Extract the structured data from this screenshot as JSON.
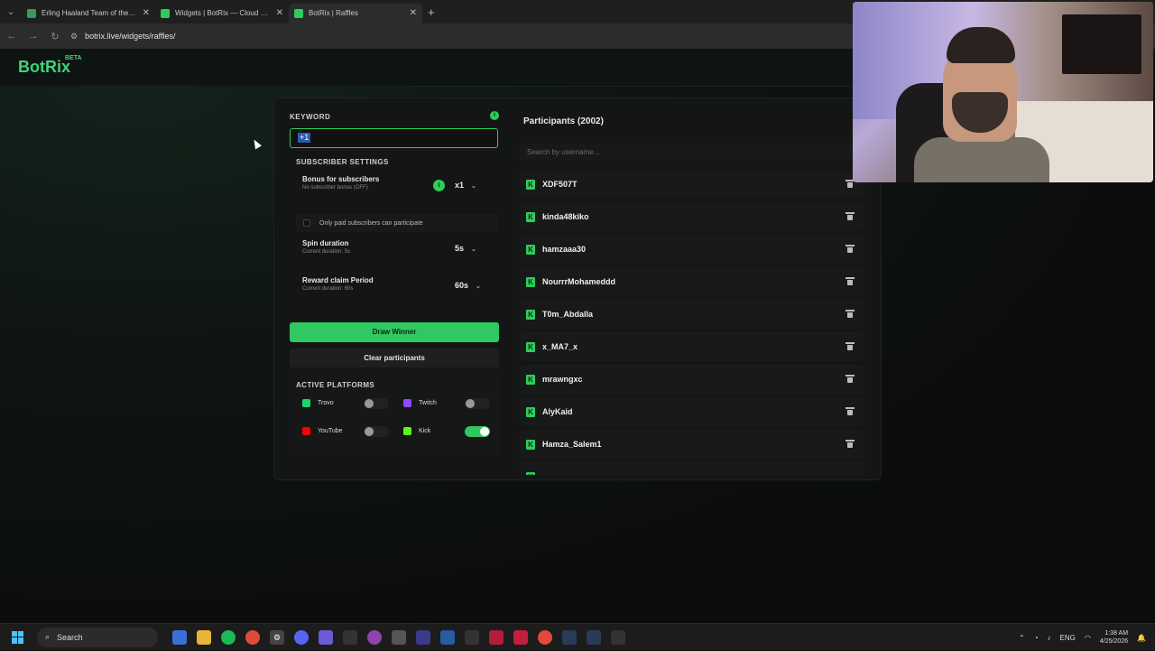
{
  "browser": {
    "tabs": [
      {
        "title": "Erling Haaland Team of the Sea",
        "active": false,
        "favicon_color": "#3b9a5a"
      },
      {
        "title": "Widgets | BotRix — Cloud Stre",
        "active": false,
        "favicon_color": "#2ecc5a"
      },
      {
        "title": "BotRix | Raffles",
        "active": true,
        "favicon_color": "#2ecc5a"
      }
    ],
    "url": "botrix.live/widgets/raffles/"
  },
  "app": {
    "logo": "BotRix",
    "beta_badge": "BETA",
    "brand_color": "#2ecc5a"
  },
  "keyword": {
    "label": "KEYWORD",
    "value": "+1"
  },
  "subscriber_settings": {
    "title": "SUBSCRIBER SETTINGS",
    "bonus_title": "Bonus for subscribers",
    "bonus_sub": "No subscriber bonus (OFF)",
    "bonus_value": "x1",
    "paid_only_label": "Only paid subscribers can participate",
    "spin_title": "Spin duration",
    "spin_sub": "Current duration: 5s",
    "spin_value": "5s",
    "reward_title": "Reward claim Period",
    "reward_sub": "Current duration: 60s",
    "reward_value": "60s"
  },
  "actions": {
    "draw": "Draw Winner",
    "clear": "Clear participants"
  },
  "platforms": {
    "title": "ACTIVE PLATFORMS",
    "items": [
      {
        "name": "Trovo",
        "enabled": false,
        "icon": "trovo-icon",
        "color": "#19d66b"
      },
      {
        "name": "Twitch",
        "enabled": false,
        "icon": "twitch-icon",
        "color": "#9146ff"
      },
      {
        "name": "YouTube",
        "enabled": false,
        "icon": "youtube-icon",
        "color": "#ff0000"
      },
      {
        "name": "Kick",
        "enabled": true,
        "icon": "kick-icon",
        "color": "#53fc18"
      }
    ]
  },
  "participants": {
    "title": "Participants (2002)",
    "search_placeholder": "Search by username...",
    "list": [
      "XDF507T",
      "kinda48kiko",
      "hamzaaa30",
      "NourrrMohameddd",
      "T0m_Abdalla",
      "x_MA7_x",
      "mrawngxc",
      "AlyKaid",
      "Hamza_Salem1"
    ]
  },
  "taskbar": {
    "search_label": "Search",
    "language": "ENG",
    "time": "1:38 AM",
    "date": "4/25/2026"
  }
}
